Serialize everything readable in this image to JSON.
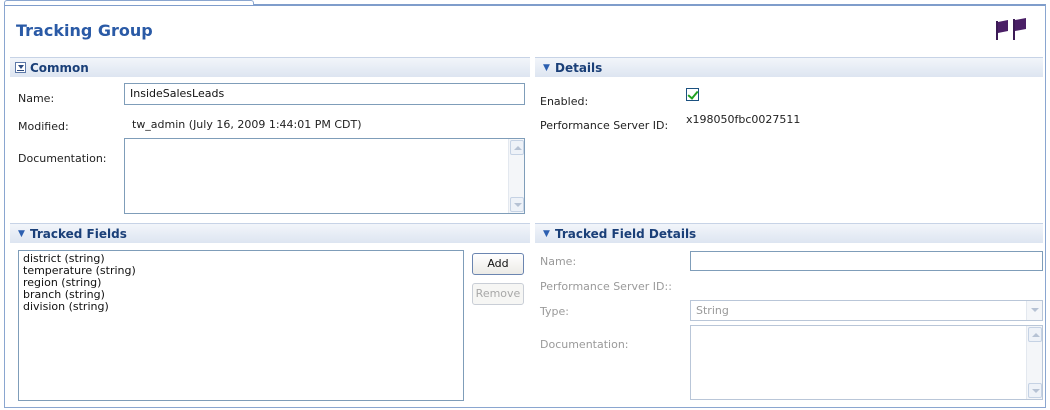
{
  "page": {
    "title": "Tracking Group"
  },
  "common": {
    "header": "Common",
    "name_label": "Name:",
    "name_value": "InsideSalesLeads",
    "modified_label": "Modified:",
    "modified_value": "tw_admin (July 16, 2009 1:44:01 PM CDT)",
    "documentation_label": "Documentation:",
    "documentation_value": ""
  },
  "details": {
    "header": "Details",
    "enabled_label": "Enabled:",
    "enabled_checked": true,
    "perf_server_label": "Performance Server ID:",
    "perf_server_value": "x198050fbc0027511"
  },
  "tracked_fields": {
    "header": "Tracked Fields",
    "items": [
      "district (string)",
      "temperature (string)",
      "region (string)",
      "branch (string)",
      "division (string)"
    ],
    "add_label": "Add",
    "remove_label": "Remove"
  },
  "tracked_field_details": {
    "header": "Tracked Field Details",
    "name_label": "Name:",
    "name_value": "",
    "perf_server_label": "Performance Server ID::",
    "type_label": "Type:",
    "type_value": "String",
    "documentation_label": "Documentation:",
    "documentation_value": ""
  },
  "colors": {
    "title": "#2a5aa6",
    "section_header": "#1a3f78",
    "flag": "#4a1f66",
    "checkmark": "#21a121"
  },
  "icons": {
    "flags": "flags-icon",
    "collapse": "collapse-icon",
    "section_toggle": "triangle-down-icon"
  }
}
